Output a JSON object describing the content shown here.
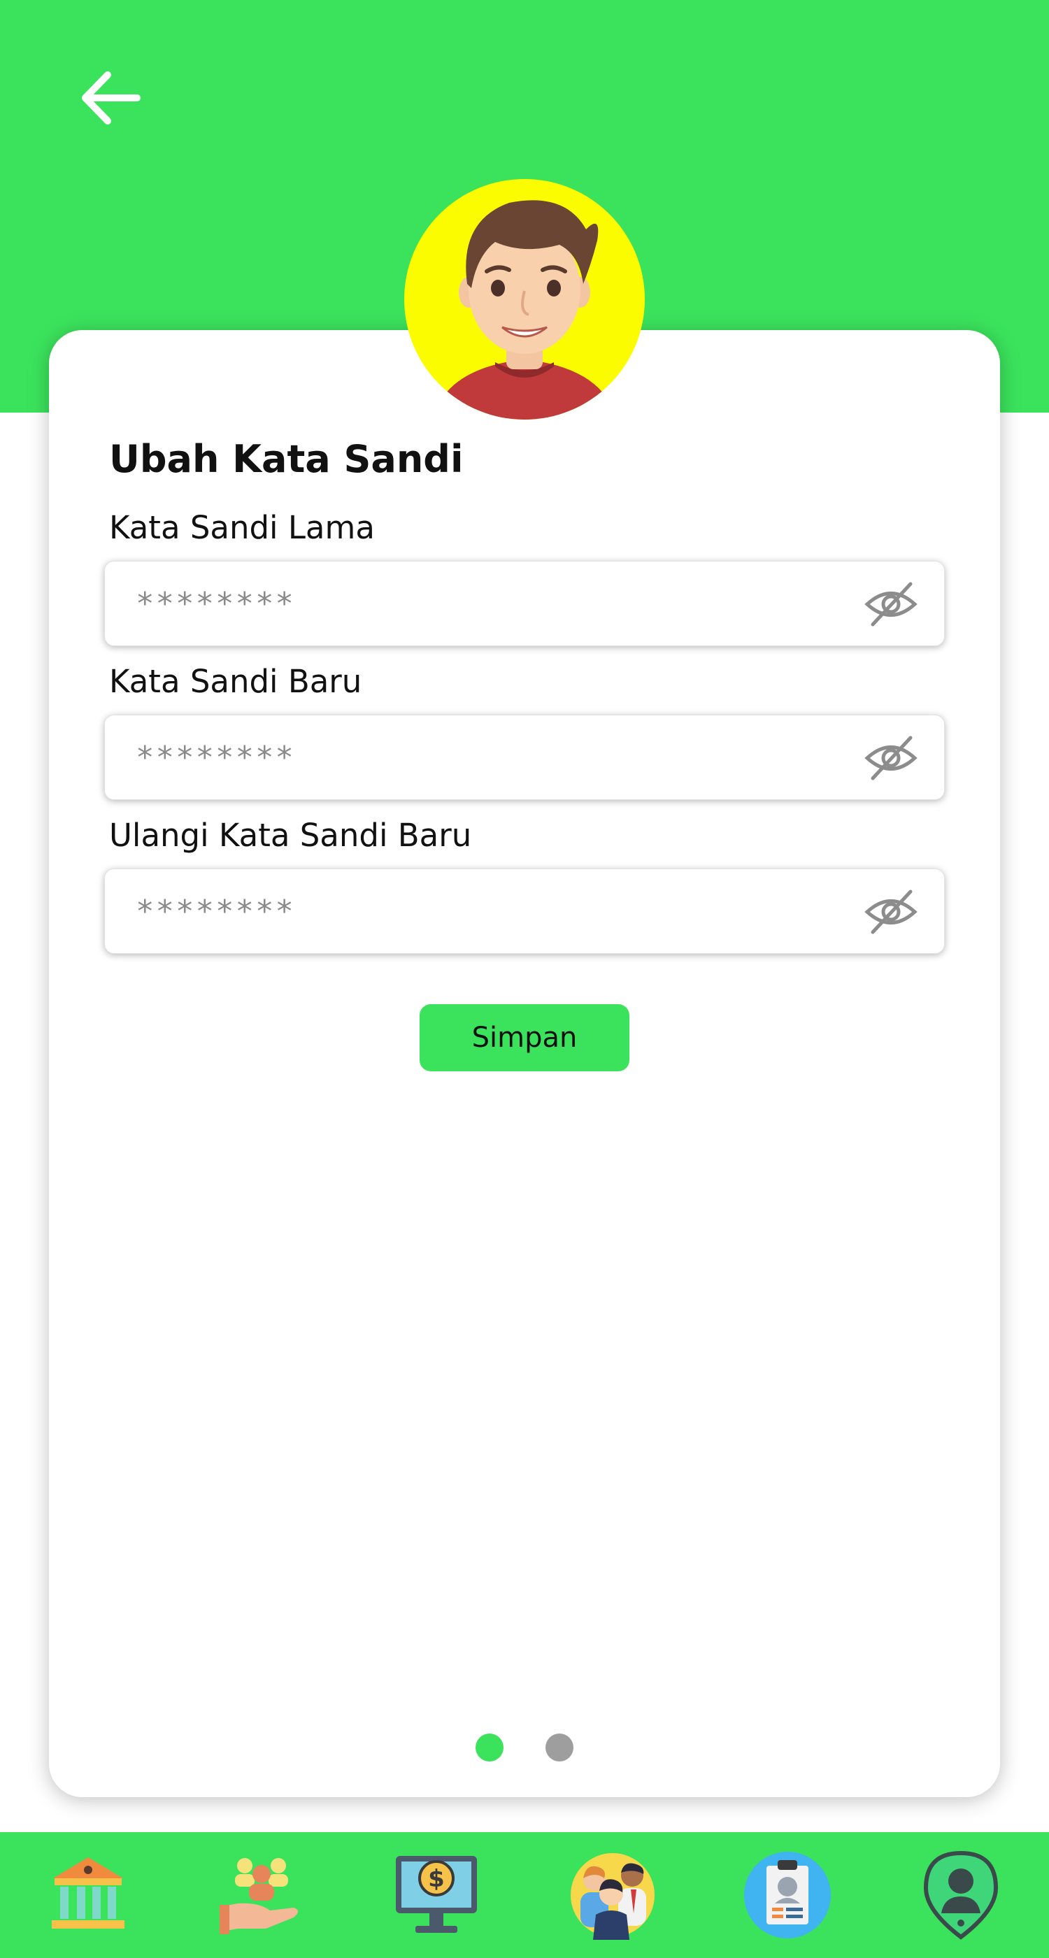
{
  "header": {
    "back_icon": "arrow-left-icon",
    "color": "#3be35c"
  },
  "form": {
    "title": "Ubah Kata Sandi",
    "fields": [
      {
        "label": "Kata Sandi Lama",
        "placeholder": "********",
        "icon": "eye-off-icon"
      },
      {
        "label": "Kata Sandi Baru",
        "placeholder": "********",
        "icon": "eye-off-icon"
      },
      {
        "label": "Ulangi Kata Sandi Baru",
        "placeholder": "********",
        "icon": "eye-off-icon"
      }
    ],
    "save_label": "Simpan"
  },
  "pagination": {
    "count": 2,
    "active": 1,
    "active_color": "#3be35c",
    "inactive_color": "#9e9e9e"
  },
  "bottom_nav": [
    {
      "icon": "bank-icon"
    },
    {
      "icon": "community-hand-icon"
    },
    {
      "icon": "monitor-dollar-icon"
    },
    {
      "icon": "people-group-icon"
    },
    {
      "icon": "id-clipboard-icon"
    },
    {
      "icon": "location-person-icon"
    }
  ]
}
